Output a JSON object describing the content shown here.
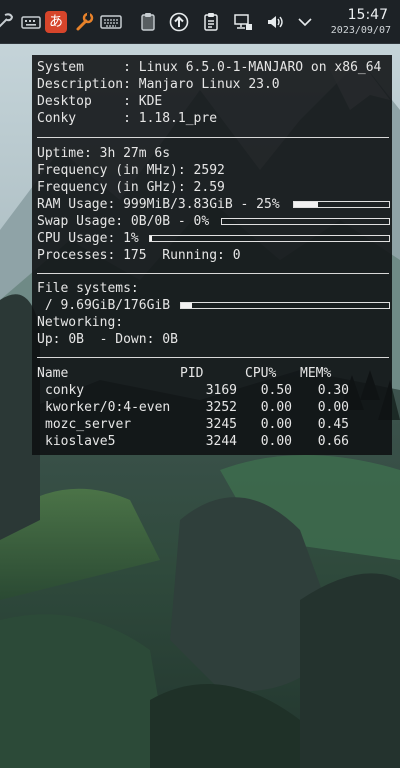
{
  "panel": {
    "icons": [
      "settings-tool-icon",
      "keyboard-icon",
      "mozc-ime-icon",
      "wrench-icon",
      "keyboard-layout-icon",
      "clipboard-icon",
      "update-arrow-icon",
      "clipboard-list-icon",
      "network-icon",
      "volume-icon",
      "chevron-down-icon"
    ],
    "ime_char": "あ",
    "time": "15:47",
    "date": "2023/09/07"
  },
  "conky": {
    "system": [
      {
        "label": "System     ",
        "sep": ": ",
        "value": "Linux 6.5.0-1-MANJARO on x86_64"
      },
      {
        "label": "Description",
        "sep": ": ",
        "value": "Manjaro Linux 23.0"
      },
      {
        "label": "Desktop    ",
        "sep": ": ",
        "value": "KDE"
      },
      {
        "label": "Conky      ",
        "sep": ": ",
        "value": "1.18.1_pre"
      }
    ],
    "uptime_label": "Uptime:",
    "uptime": "3h 27m 6s",
    "freq_mhz_label": "Frequency (in MHz):",
    "freq_mhz": "2592",
    "freq_ghz_label": "Frequency (in GHz):",
    "freq_ghz": "2.59",
    "ram_label": "RAM Usage:",
    "ram_value": "999MiB/3.83GiB - 25%",
    "ram_fraction": 0.25,
    "swap_label": "Swap Usage:",
    "swap_value": "0B/0B - 0%",
    "swap_fraction": 0.0,
    "cpu_label": "CPU Usage:",
    "cpu_value": "1%",
    "cpu_fraction": 0.01,
    "processes_label": "Processes:",
    "processes": "175",
    "running_label": "Running:",
    "running": "0",
    "fs_label": "File systems:",
    "fs_mount": "/",
    "fs_value": "9.69GiB/176GiB",
    "fs_fraction": 0.055,
    "net_label": "Networking:",
    "up_label": "Up:",
    "up_value": "0B",
    "down_label": "- Down:",
    "down_value": "0B",
    "table_headers": {
      "name": "Name",
      "pid": "PID",
      "cpu": "CPU%",
      "mem": "MEM%"
    },
    "processes_top": [
      {
        "name": "conky",
        "pid": "3169",
        "cpu": "0.50",
        "mem": "0.30"
      },
      {
        "name": "kworker/0:4-even",
        "pid": "3252",
        "cpu": "0.00",
        "mem": "0.00"
      },
      {
        "name": "mozc_server",
        "pid": "3245",
        "cpu": "0.00",
        "mem": "0.45"
      },
      {
        "name": "kioslave5",
        "pid": "3244",
        "cpu": "0.00",
        "mem": "0.66"
      }
    ]
  }
}
